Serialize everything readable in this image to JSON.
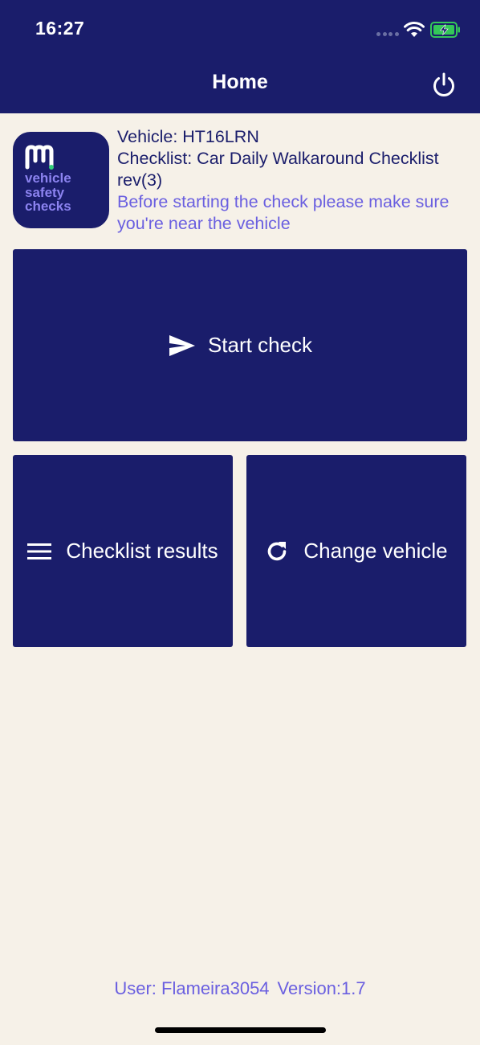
{
  "status_bar": {
    "time": "16:27"
  },
  "header": {
    "title": "Home",
    "power_icon": "power-icon"
  },
  "logo": {
    "lines": [
      "vehicle",
      "safety",
      "checks"
    ],
    "accent_color": "#8c83f0"
  },
  "info": {
    "vehicle": "Vehicle: HT16LRN",
    "checklist": "Checklist: Car Daily Walkaround Checklist rev(3)",
    "note": "Before starting the check please make sure you're near the vehicle"
  },
  "actions": {
    "start_check": {
      "label": "Start check",
      "icon": "send-icon"
    },
    "checklist_results": {
      "label": "Checklist results",
      "icon": "menu-icon"
    },
    "change_vehicle": {
      "label": "Change vehicle",
      "icon": "refresh-icon"
    }
  },
  "footer": {
    "user": "User: Flameira3054",
    "version": "Version:1.7"
  },
  "colors": {
    "primary": "#1a1d6b",
    "background": "#f6f1e8",
    "accent": "#6a5fe0",
    "battery": "#34c759"
  }
}
